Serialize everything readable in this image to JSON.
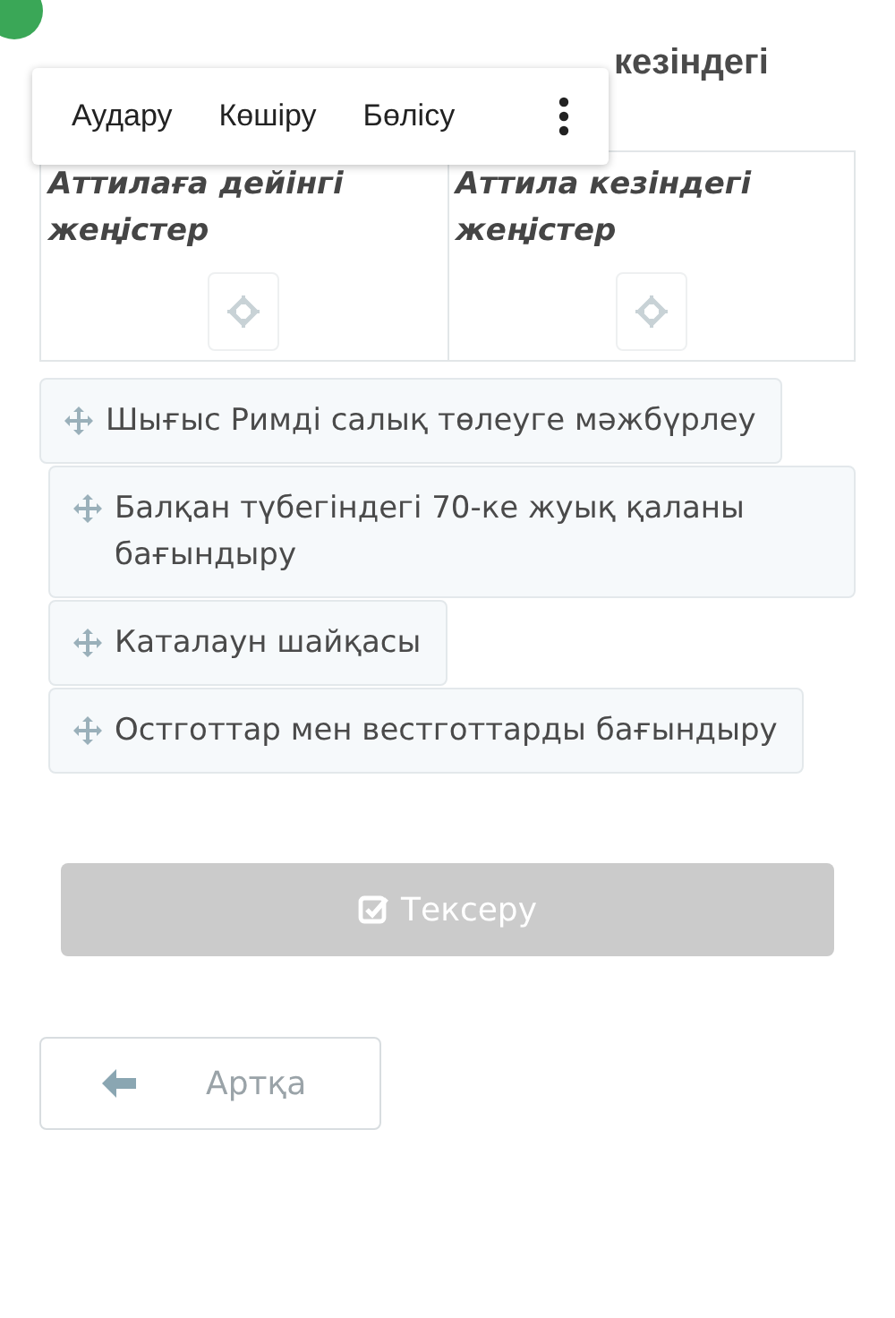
{
  "title": "кезіндегі",
  "context_menu": {
    "items": [
      {
        "label": "Аудару"
      },
      {
        "label": "Көшіру"
      },
      {
        "label": "Бөлісу"
      }
    ]
  },
  "columns": [
    {
      "heading": "Аттилаға дейінгі жеңістер"
    },
    {
      "heading": "Аттила кезіндегі жеңістер"
    }
  ],
  "answers": [
    {
      "label": "Шығыс Римді салық төлеуге мәжбүрлеу"
    },
    {
      "label": "Балқан түбегіндегі 70-ке жуық қаланы бағындыру"
    },
    {
      "label": "Каталаун шайқасы"
    },
    {
      "label": "Остготтар мен вестготтарды бағындыру"
    }
  ],
  "check_button": {
    "label": "Тексеру",
    "disabled": true
  },
  "back_button": {
    "label": "Артқа"
  }
}
